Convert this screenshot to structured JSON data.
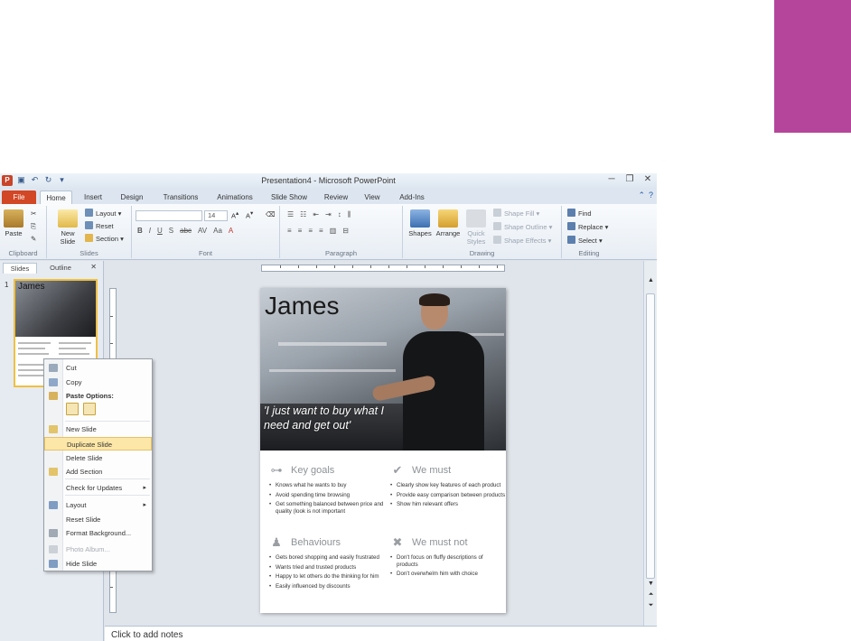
{
  "window": {
    "title": "Presentation4 - Microsoft PowerPoint",
    "app_icon": "P",
    "controls": [
      "─",
      "❐",
      "✕"
    ]
  },
  "tabs": [
    "File",
    "Home",
    "Insert",
    "Design",
    "Transitions",
    "Animations",
    "Slide Show",
    "Review",
    "View",
    "Add-Ins"
  ],
  "ribbon": {
    "clipboard": {
      "label": "Clipboard",
      "paste": "Paste"
    },
    "slides": {
      "label": "Slides",
      "new_slide": "New Slide",
      "layout": "Layout",
      "reset": "Reset",
      "section": "Section"
    },
    "font": {
      "label": "Font",
      "size": "14",
      "buttons": [
        "B",
        "I",
        "U",
        "S",
        "abc",
        "AV",
        "Aa",
        "A"
      ]
    },
    "paragraph": {
      "label": "Paragraph"
    },
    "drawing": {
      "label": "Drawing",
      "shapes": "Shapes",
      "arrange": "Arrange",
      "quick_styles": "Quick Styles",
      "shape_fill": "Shape Fill",
      "shape_outline": "Shape Outline",
      "shape_effects": "Shape Effects"
    },
    "editing": {
      "label": "Editing",
      "find": "Find",
      "replace": "Replace",
      "select": "Select"
    }
  },
  "left_panel": {
    "tabs": [
      "Slides",
      "Outline"
    ],
    "close": "✕",
    "thumb_number": "1",
    "thumb_name": "James"
  },
  "slide": {
    "name": "James",
    "quote": "'I just want to buy what I need and get out'",
    "sections": [
      {
        "title": "Key goals",
        "icon": "key-icon",
        "items": [
          "Knows what he wants to buy",
          "Avoid spending time browsing",
          "Get something balanced between price and quality (look is not important"
        ]
      },
      {
        "title": "We must",
        "icon": "checkmark-icon",
        "items": [
          "Clearly show key features of each product",
          "Provide easy comparison between products",
          "Show him relevant offers"
        ]
      },
      {
        "title": "Behaviours",
        "icon": "person-icon",
        "items": [
          "Gets bored shopping and easily frustrated",
          "Wants tried and trusted products",
          "Happy to let others do the thinking for him",
          "Easily influenced by discounts"
        ]
      },
      {
        "title": "We must not",
        "icon": "cross-icon",
        "items": [
          "Don't focus on fluffy descriptions of products",
          "Don't overwhelm him with choice"
        ]
      }
    ]
  },
  "notes_placeholder": "Click to add notes",
  "context_menu": {
    "cut": "Cut",
    "copy": "Copy",
    "paste_options": "Paste Options:",
    "new_slide": "New Slide",
    "duplicate_slide": "Duplicate Slide",
    "delete_slide": "Delete Slide",
    "add_section": "Add Section",
    "check_updates": "Check for Updates",
    "layout": "Layout",
    "reset_slide": "Reset Slide",
    "format_background": "Format Background...",
    "photo_album": "Photo Album...",
    "hide_slide": "Hide Slide"
  },
  "colors": {
    "accent_block": "#b5459a",
    "file_tab": "#d24726",
    "menu_highlight": "#fce7a8"
  }
}
